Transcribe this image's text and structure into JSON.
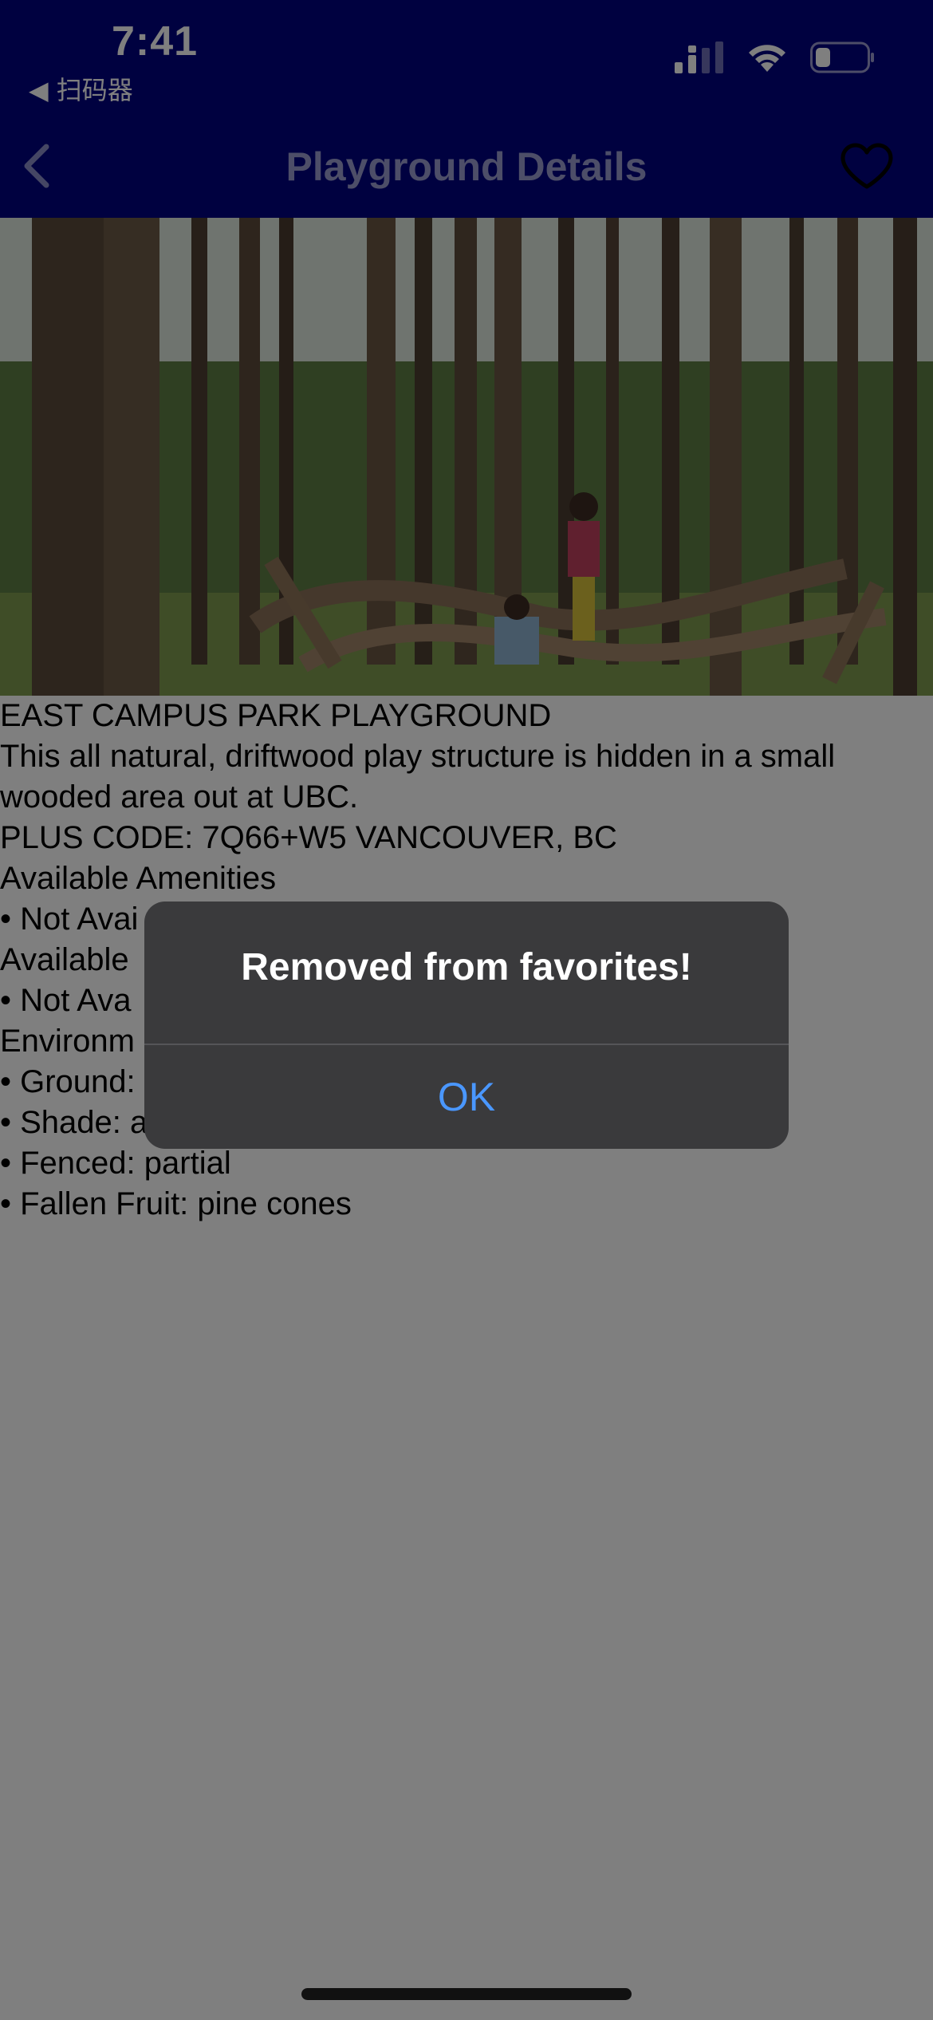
{
  "status_bar": {
    "time": "7:41",
    "back_app": "◀ 扫码器",
    "icons": [
      "cellular-signal-icon",
      "wifi-icon",
      "battery-icon"
    ]
  },
  "nav": {
    "title": "Playground Details",
    "back_icon": "chevron-left-icon",
    "favorite_icon": "heart-outline-icon"
  },
  "playground": {
    "name": "EAST CAMPUS PARK PLAYGROUND",
    "description": "This all natural, driftwood play structure is hidden in a small wooded area out at UBC.",
    "plus_code": "PLUS CODE: 7Q66+W5 VANCOUVER, BC",
    "amenities_heading": "Available Amenities",
    "amenities_item": "• Not Avai",
    "facilities_heading": "Available",
    "facilities_item": "• Not Ava",
    "environment_heading": "Environm",
    "env_ground": "• Ground:",
    "env_shade": "• Shade: a",
    "env_fenced": "• Fenced: partial",
    "env_fruit": "• Fallen Fruit: pine cones"
  },
  "alert": {
    "message": "Removed from favorites!",
    "ok_label": "OK"
  },
  "colors": {
    "nav_background": "#010280",
    "alert_background": "#3a3a3c",
    "alert_button": "#4a97ff"
  }
}
